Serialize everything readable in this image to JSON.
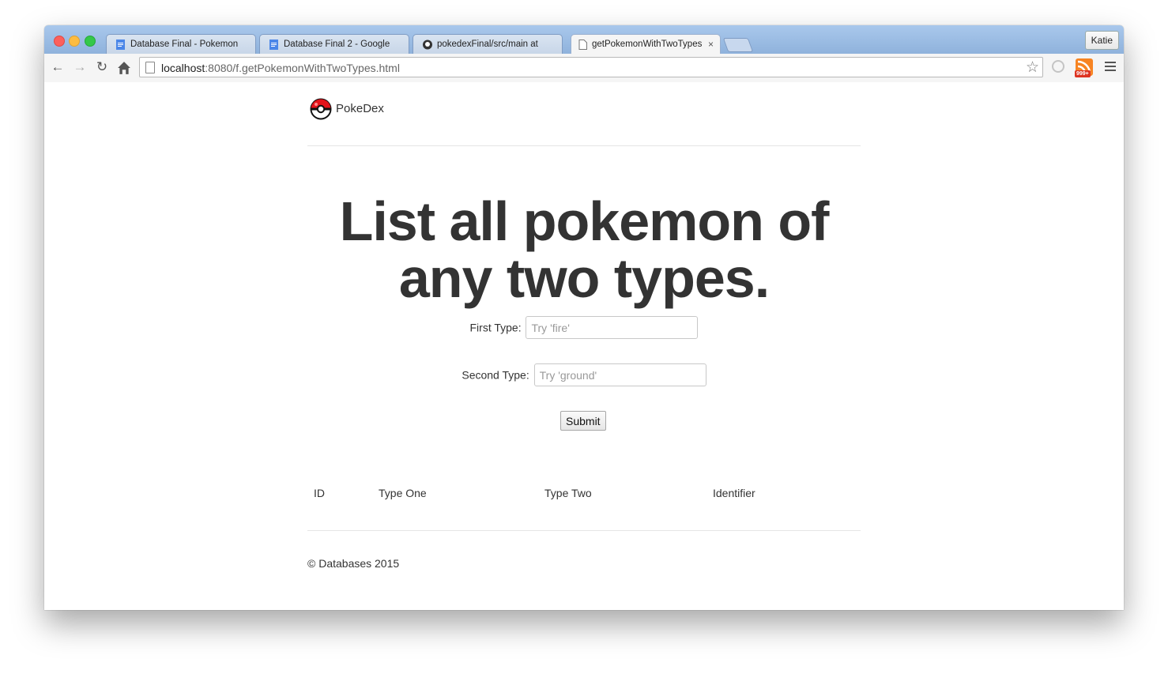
{
  "browser": {
    "tabs": [
      {
        "title": "Database Final - Pokemon"
      },
      {
        "title": "Database Final 2 - Google"
      },
      {
        "title": "pokedexFinal/src/main at"
      },
      {
        "title": "getPokemonWithTwoTypes",
        "close": "×"
      }
    ],
    "profile": "Katie",
    "url_host": "localhost",
    "url_rest": ":8080/f.getPokemonWithTwoTypes.html",
    "rss_badge": "999+"
  },
  "page": {
    "brand": "PokeDex",
    "headline": "List all pokemon of any two types.",
    "first_type": {
      "label": "First Type:",
      "placeholder": "Try 'fire'",
      "value": ""
    },
    "second_type": {
      "label": "Second Type:",
      "placeholder": "Try 'ground'",
      "value": ""
    },
    "submit": "Submit",
    "table_headers": [
      "ID",
      "Type One",
      "Type Two",
      "Identifier"
    ],
    "footer": "© Databases 2015"
  },
  "colors": {
    "tabstrip": "#a9c8ec",
    "text": "#333333",
    "divider": "#e5e5e5"
  }
}
